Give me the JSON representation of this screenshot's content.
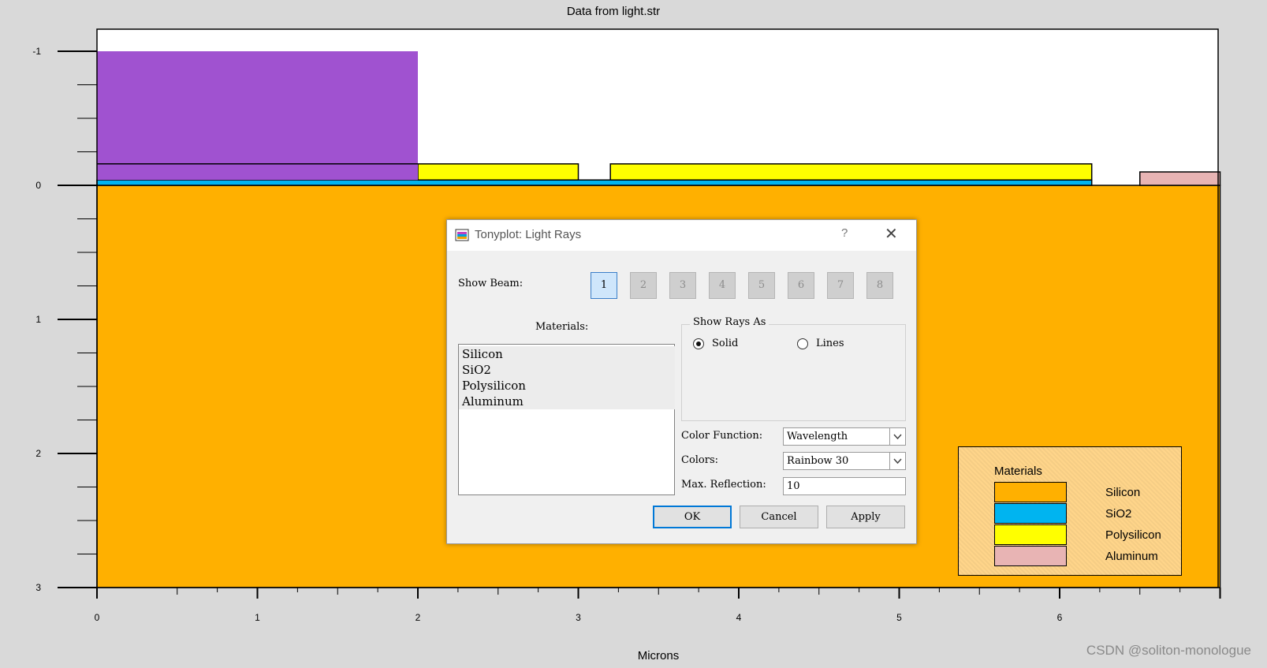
{
  "plot": {
    "title": "Data from light.str",
    "x_axis_title": "Microns",
    "x_ticks": [
      "0",
      "1",
      "2",
      "3",
      "4",
      "5",
      "6"
    ],
    "y_ticks": [
      "-1",
      "0",
      "1",
      "2",
      "3"
    ]
  },
  "chart_data": {
    "type": "cross-section",
    "title": "Data from light.str",
    "xlabel": "Microns",
    "ylabel": "",
    "xlim": [
      0,
      7
    ],
    "ylim": [
      -1,
      3
    ],
    "y_inverted": true,
    "regions": [
      {
        "material": "Silicon",
        "x": [
          0,
          7
        ],
        "y": [
          0,
          3
        ]
      },
      {
        "material": "SiO2",
        "x": [
          0,
          6.2
        ],
        "y": [
          -0.04,
          0
        ]
      },
      {
        "material": "Polysilicon",
        "x": [
          2,
          3
        ],
        "y": [
          -0.16,
          -0.04
        ]
      },
      {
        "material": "Polysilicon",
        "x": [
          3.2,
          6.2
        ],
        "y": [
          -0.16,
          -0.04
        ]
      },
      {
        "material": "Aluminum",
        "x": [
          6.5,
          7
        ],
        "y": [
          -0.1,
          0
        ]
      },
      {
        "material": "Light beam",
        "x": [
          0,
          2
        ],
        "y": [
          -1,
          -0.04
        ]
      }
    ]
  },
  "colors": {
    "silicon": "#ffb000",
    "sio2": "#00b4f0",
    "polysilicon": "#ffff00",
    "aluminum": "#e8b4b4",
    "beam": "#a052d0"
  },
  "legend": {
    "title": "Materials",
    "items": [
      {
        "label": "Silicon",
        "color": "#ffb000"
      },
      {
        "label": "SiO2",
        "color": "#00b4f0"
      },
      {
        "label": "Polysilicon",
        "color": "#ffff00"
      },
      {
        "label": "Aluminum",
        "color": "#e8b4b4"
      }
    ]
  },
  "dialog": {
    "title": "Tonyplot: Light Rays",
    "help_label": "?",
    "close_label": "✕",
    "show_beam_label": "Show Beam:",
    "beams": [
      "1",
      "2",
      "3",
      "4",
      "5",
      "6",
      "7",
      "8"
    ],
    "active_beam": "1",
    "materials_label": "Materials:",
    "materials": [
      "Silicon",
      "SiO2",
      "Polysilicon",
      "Aluminum"
    ],
    "show_rays_as_label": "Show Rays As",
    "solid_label": "Solid",
    "lines_label": "Lines",
    "selected_ray_mode": "Solid",
    "color_function_label": "Color Function:",
    "color_function_value": "Wavelength",
    "colors_label": "Colors:",
    "colors_value": "Rainbow 30",
    "max_reflection_label": "Max. Reflection:",
    "max_reflection_value": "10",
    "ok_label": "OK",
    "cancel_label": "Cancel",
    "apply_label": "Apply"
  },
  "watermark": "CSDN @soliton-monologue"
}
